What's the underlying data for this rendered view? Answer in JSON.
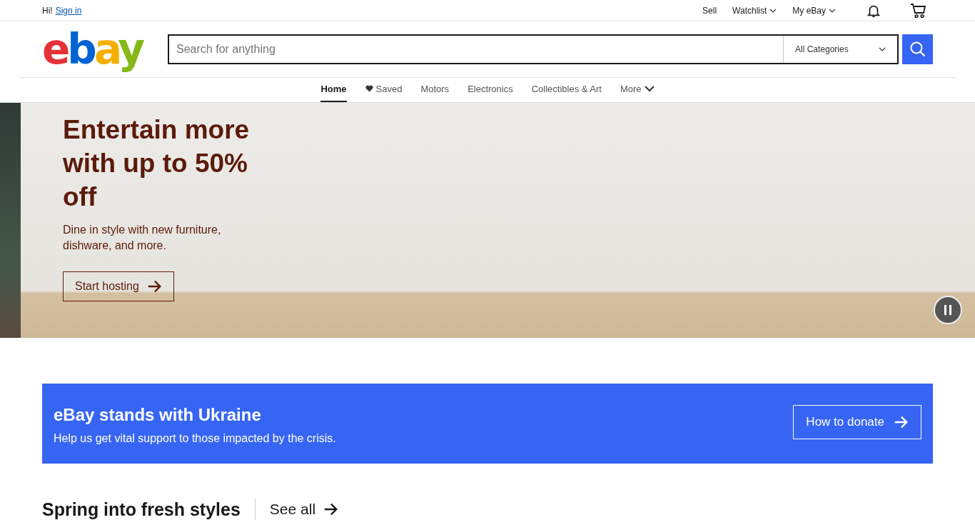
{
  "top_bar": {
    "greeting": "Hi!",
    "sign_in": "Sign in",
    "links": [
      {
        "label": "Sell",
        "dropdown": false
      },
      {
        "label": "Watchlist",
        "dropdown": true
      },
      {
        "label": "My eBay",
        "dropdown": true
      }
    ]
  },
  "logo": {
    "letters": [
      {
        "char": "e",
        "color": "#e53238"
      },
      {
        "char": "b",
        "color": "#0064d2"
      },
      {
        "char": "a",
        "color": "#f5af02"
      },
      {
        "char": "y",
        "color": "#86b817"
      }
    ]
  },
  "search": {
    "placeholder": "Search for anything",
    "category": "All Categories"
  },
  "nav": [
    {
      "label": "Home",
      "selected": true,
      "kind": "plain"
    },
    {
      "label": "Saved",
      "selected": false,
      "kind": "saved"
    },
    {
      "label": "Motors",
      "selected": false,
      "kind": "plain"
    },
    {
      "label": "Electronics",
      "selected": false,
      "kind": "plain"
    },
    {
      "label": "Collectibles & Art",
      "selected": false,
      "kind": "plain"
    },
    {
      "label": "More",
      "selected": false,
      "kind": "more"
    }
  ],
  "hero": {
    "title": "Entertain more with up to 50% off",
    "subtitle": "Dine in style with new furniture, dishware, and more.",
    "button": "Start hosting"
  },
  "ukraine_banner": {
    "title": "eBay stands with Ukraine",
    "text": "Help us get vital support to those impacted by the crisis.",
    "button": "How to donate"
  },
  "section": {
    "title": "Spring into fresh styles",
    "link": "See all"
  }
}
